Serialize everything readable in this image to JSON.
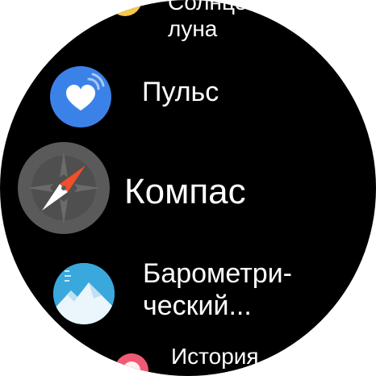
{
  "menu": {
    "items": [
      {
        "id": "sun-moon",
        "line1": "Солнце и",
        "line2": "луна",
        "icon": "sun-moon-icon",
        "color": "#f6c94a"
      },
      {
        "id": "pulse",
        "label": "Пульс",
        "icon": "heart-icon",
        "color": "#3b82e8"
      },
      {
        "id": "compass",
        "label": "Компас",
        "icon": "compass-icon",
        "color": "#5a5a5a"
      },
      {
        "id": "barometer",
        "line1": "Барометри-",
        "line2": "ческий...",
        "icon": "mountain-icon",
        "color": "#3aa8dc"
      },
      {
        "id": "history",
        "label": "История",
        "icon": "history-icon",
        "color": "#f05a74"
      }
    ]
  }
}
